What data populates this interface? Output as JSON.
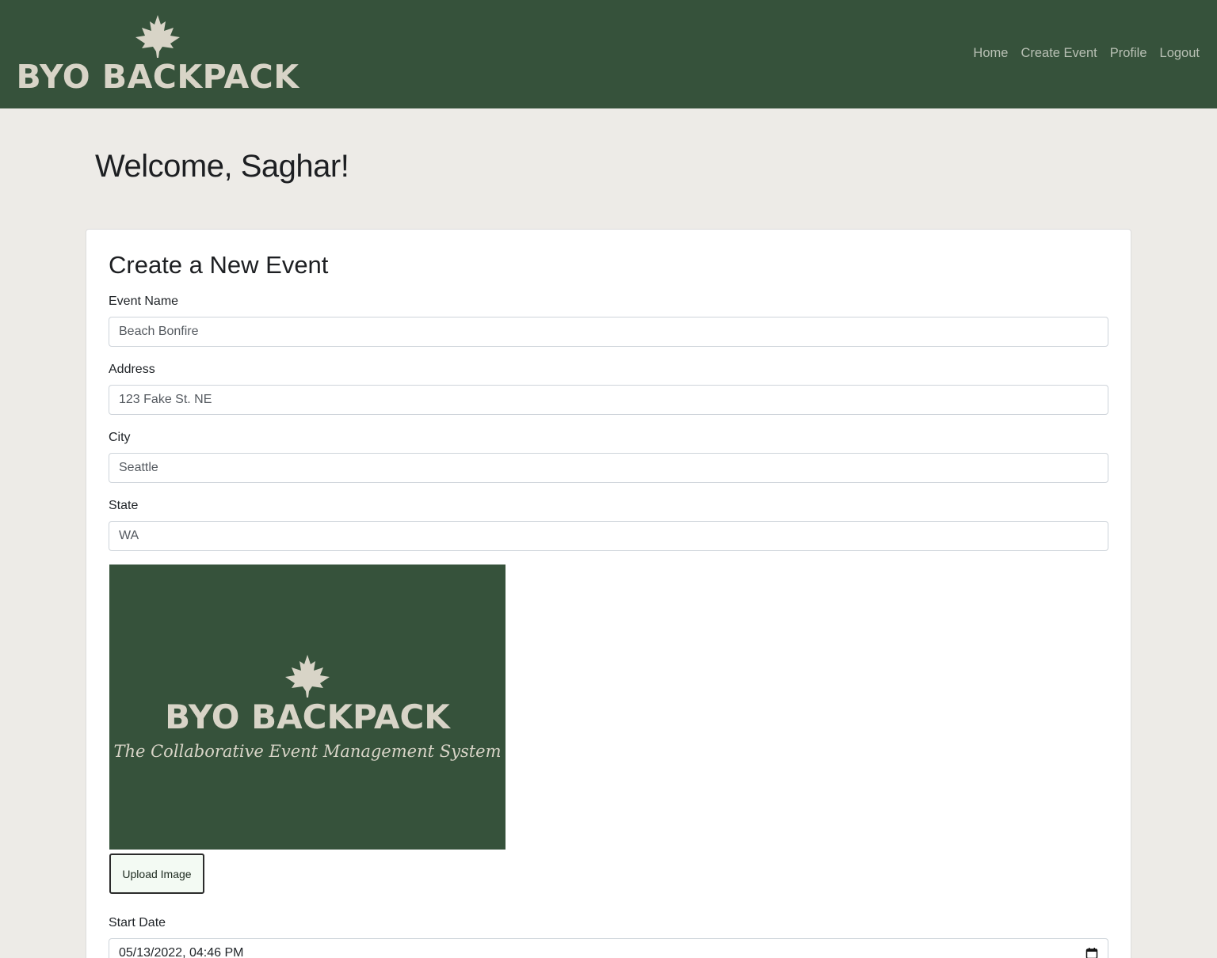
{
  "nav": {
    "brand": "BYO BACKPACK",
    "links": [
      "Home",
      "Create Event",
      "Profile",
      "Logout"
    ]
  },
  "welcome": "Welcome, Saghar!",
  "form": {
    "title": "Create a New Event",
    "fields": [
      {
        "label": "Event Name",
        "value": "Beach Bonfire"
      },
      {
        "label": "Address",
        "value": "123 Fake St. NE"
      },
      {
        "label": "City",
        "value": "Seattle"
      },
      {
        "label": "State",
        "value": "WA"
      }
    ],
    "preview": {
      "title": "BYO BACKPACK",
      "tagline": "The Collaborative Event Management System"
    },
    "upload_label": "Upload Image",
    "start_date": {
      "label": "Start Date",
      "value": "05/13/2022, 04:46 PM"
    }
  },
  "colors": {
    "brand_green": "#36523b",
    "logo_cream": "#d8d4c7",
    "page_bg": "#edebe7"
  },
  "icons": [
    "maple-leaf-icon",
    "calendar-icon"
  ]
}
